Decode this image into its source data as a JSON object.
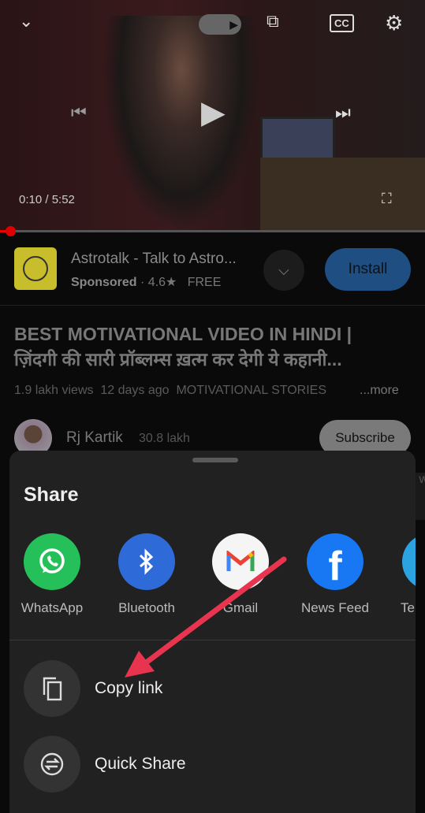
{
  "player": {
    "time": "0:10 / 5:52",
    "progress_percent": 2.8
  },
  "ad": {
    "title": "Astrotalk - Talk to Astro...",
    "sponsored": "Sponsored",
    "rating": "· 4.6★",
    "price": "FREE",
    "install_label": "Install"
  },
  "video": {
    "title_line1": "BEST MOTIVATIONAL VIDEO IN HINDI |",
    "title_line2": "ज़िंदगी की सारी प्रॉब्लम्स ख़त्म कर देगी ये कहानी...",
    "views": "1.9 lakh views",
    "age": "12 days ago",
    "tag": "MOTIVATIONAL STORIES",
    "more": "...more"
  },
  "channel": {
    "name": "Rj Kartik",
    "subscribers": "30.8 lakh",
    "subscribe_label": "Subscribe"
  },
  "share": {
    "title": "Share",
    "apps": [
      {
        "label": "WhatsApp",
        "color": "#25c05a"
      },
      {
        "label": "Bluetooth",
        "color": "#2f6bd8"
      },
      {
        "label": "Gmail",
        "color": "#f5f5f5"
      },
      {
        "label": "News Feed",
        "color": "#1877f2"
      },
      {
        "label": "Te",
        "color": "#2aa3e0"
      }
    ],
    "actions": [
      {
        "label": "Copy link"
      },
      {
        "label": "Quick Share"
      }
    ]
  },
  "annotation": {
    "arrow_color": "#e8344e"
  }
}
